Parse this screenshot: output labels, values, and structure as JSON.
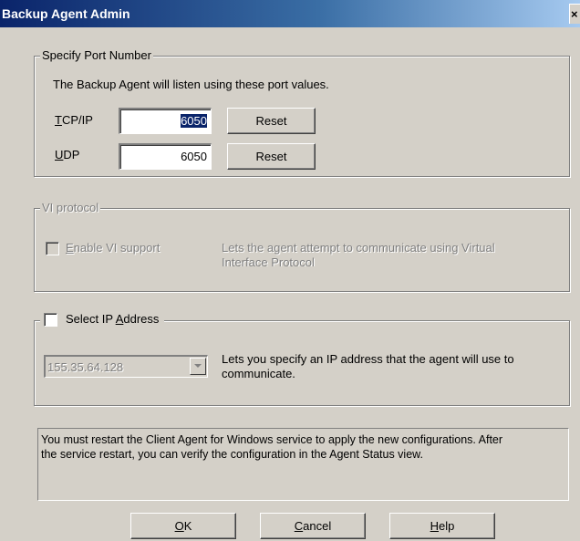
{
  "window": {
    "title": "Backup Agent Admin",
    "close_glyph": "×"
  },
  "port_group": {
    "legend": "Specify Port Number",
    "description": "The Backup Agent will listen using these port values.",
    "tcp_label_ul": "T",
    "tcp_label_rest": "CP/IP",
    "tcp_value": "6050",
    "udp_label_ul": "U",
    "udp_label_rest": "DP",
    "udp_value": "6050",
    "reset_label": "Reset"
  },
  "vi_group": {
    "legend": "VI protocol",
    "enable_ul": "E",
    "enable_rest": "nable VI support",
    "description_line1": "Lets the agent attempt to communicate using Virtual",
    "description_line2": "Interface Protocol"
  },
  "ip_group": {
    "checkbox_pre": "Select IP ",
    "checkbox_ul": "A",
    "checkbox_post": "ddress",
    "ip_value": "155.35.64.128",
    "description_line1": "Lets you specify an IP address that the agent will use to",
    "description_line2": "communicate."
  },
  "info": {
    "line1": "You must restart the Client Agent for Windows service to apply the new configurations. After",
    "line2": "the service restart, you can verify the configuration in the Agent Status view."
  },
  "buttons": {
    "ok_ul": "O",
    "ok_rest": "K",
    "cancel_ul": "C",
    "cancel_rest": "ancel",
    "help_ul": "H",
    "help_rest": "elp"
  }
}
